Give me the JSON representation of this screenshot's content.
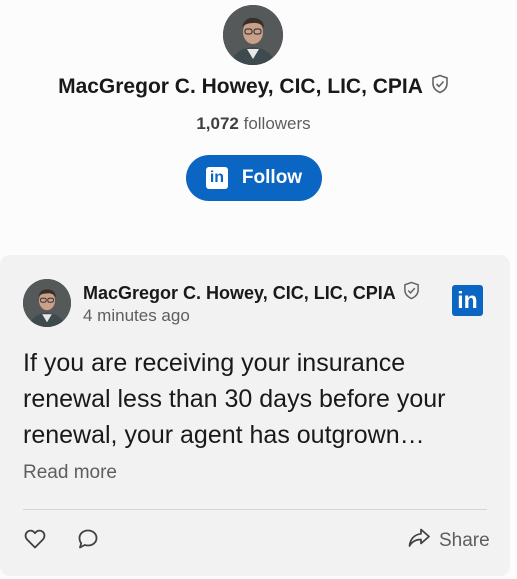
{
  "profile": {
    "name": "MacGregor C. Howey, CIC, LIC, CPIA",
    "followers_count": "1,072",
    "followers_label": "followers",
    "follow_label": "Follow",
    "linkedin_badge": "in"
  },
  "post": {
    "author": "MacGregor C. Howey, CIC, LIC, CPIA",
    "time": "4 minutes ago",
    "text": "If you are receiving your insurance renewal less than 30 days before your renewal, your agent has outgrown…",
    "read_more": "Read more",
    "share_label": "Share",
    "logo_text": "in"
  },
  "icons": {
    "verified": "shield-check-icon",
    "like": "heart-outline-icon",
    "comment": "speech-bubble-icon",
    "share": "share-arrow-icon"
  },
  "colors": {
    "brand_blue": "#0a66c2",
    "card_bg": "#f3f2f3",
    "muted_text": "#5e5e5e"
  }
}
